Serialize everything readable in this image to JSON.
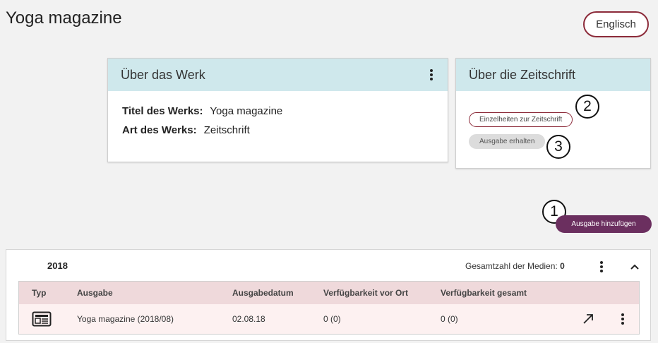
{
  "page": {
    "title": "Yoga magazine"
  },
  "language_button": {
    "label": "Englisch"
  },
  "werk_card": {
    "title": "Über das Werk",
    "fields": [
      {
        "label": "Titel des Werks:",
        "value": "Yoga magazine"
      },
      {
        "label": "Art des Werks:",
        "value": "Zeitschrift"
      }
    ]
  },
  "zeit_card": {
    "title": "Über die Zeitschrift",
    "details_button": "Einzelheiten zur Zeitschrift",
    "get_issue_button": "Ausgabe erhalten"
  },
  "markers": {
    "one": "1",
    "two": "2",
    "three": "3"
  },
  "add_issue_button": {
    "label": "Ausgabe hinzufügen"
  },
  "year_panel": {
    "year": "2018",
    "media_count_label": "Gesamtzahl der Medien:",
    "media_count_value": "0",
    "columns": [
      "Typ",
      "Ausgabe",
      "Ausgabedatum",
      "Verfügbarkeit vor Ort",
      "Verfügbarkeit gesamt"
    ],
    "rows": [
      {
        "type_icon": "newspaper-icon",
        "issue": "Yoga magazine (2018/08)",
        "date": "02.08.18",
        "local": "0 (0)",
        "total": "0 (0)"
      }
    ]
  },
  "colors": {
    "accent": "#6b2f5f",
    "border_accent": "#8c2b3a",
    "card_header": "#cfe8ec",
    "table_header": "#efd9db",
    "table_row": "#fdf1f1"
  }
}
